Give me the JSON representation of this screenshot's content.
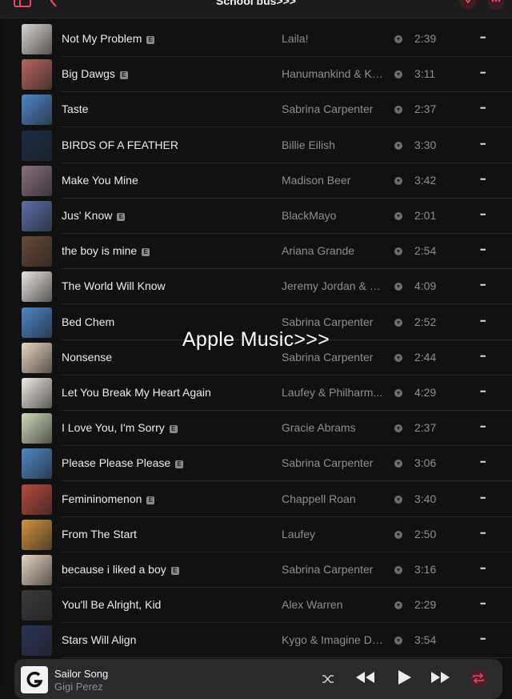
{
  "header": {
    "title": "School bus>>>"
  },
  "overlay_text": "Apple Music>>>",
  "explicit_badge": "E",
  "songs": [
    {
      "title": "Not My Problem",
      "explicit": true,
      "artist": "Laila!",
      "duration": "2:39",
      "art_color": "#d9d4cf"
    },
    {
      "title": "Big Dawgs",
      "explicit": true,
      "artist": "Hanumankind & Ka...",
      "duration": "3:11",
      "art_color": "#b8665a"
    },
    {
      "title": "Taste",
      "explicit": false,
      "artist": "Sabrina Carpenter",
      "duration": "2:37",
      "art_color": "#4f86c9"
    },
    {
      "title": "BIRDS OF A FEATHER",
      "explicit": false,
      "artist": "Billie Eilish",
      "duration": "3:30",
      "art_color": "#1a2c44"
    },
    {
      "title": "Make You Mine",
      "explicit": false,
      "artist": "Madison Beer",
      "duration": "3:42",
      "art_color": "#8a7080"
    },
    {
      "title": "Jus' Know",
      "explicit": true,
      "artist": "BlackMayo",
      "duration": "2:01",
      "art_color": "#5b70a8"
    },
    {
      "title": "the boy is mine",
      "explicit": true,
      "artist": "Ariana Grande",
      "duration": "2:54",
      "art_color": "#6a4a34"
    },
    {
      "title": "The World Will Know",
      "explicit": false,
      "artist": "Jeremy Jordan & N...",
      "duration": "4:09",
      "art_color": "#e8e4de"
    },
    {
      "title": "Bed Chem",
      "explicit": false,
      "artist": "Sabrina Carpenter",
      "duration": "2:52",
      "art_color": "#4c86c8"
    },
    {
      "title": "Nonsense",
      "explicit": false,
      "artist": "Sabrina Carpenter",
      "duration": "2:44",
      "art_color": "#e9d3bf"
    },
    {
      "title": "Let You Break My Heart Again",
      "explicit": false,
      "artist": "Laufey & Philharm...",
      "duration": "4:29",
      "art_color": "#f0ece4"
    },
    {
      "title": "I Love You, I'm Sorry",
      "explicit": true,
      "artist": "Gracie Abrams",
      "duration": "2:37",
      "art_color": "#cfd9b8"
    },
    {
      "title": "Please Please Please",
      "explicit": true,
      "artist": "Sabrina Carpenter",
      "duration": "3:06",
      "art_color": "#4f87c8"
    },
    {
      "title": "Femininomenon",
      "explicit": true,
      "artist": "Chappell Roan",
      "duration": "3:40",
      "art_color": "#b84a3c"
    },
    {
      "title": "From The Start",
      "explicit": false,
      "artist": "Laufey",
      "duration": "2:50",
      "art_color": "#d2913e"
    },
    {
      "title": "because i liked a boy",
      "explicit": true,
      "artist": "Sabrina Carpenter",
      "duration": "3:16",
      "art_color": "#e6d4c0"
    },
    {
      "title": "You'll Be Alright, Kid",
      "explicit": false,
      "artist": "Alex Warren",
      "duration": "2:29",
      "art_color": "#3a3a3c"
    },
    {
      "title": "Stars Will Align",
      "explicit": false,
      "artist": "Kygo & Imagine Dr...",
      "duration": "3:54",
      "art_color": "#2a3458"
    }
  ],
  "now_playing": {
    "title": "Sailor Song",
    "artist": "Gigi Perez"
  },
  "colors": {
    "accent": "#f0445a",
    "background": "#111112",
    "secondary_text": "#8e8e93"
  }
}
